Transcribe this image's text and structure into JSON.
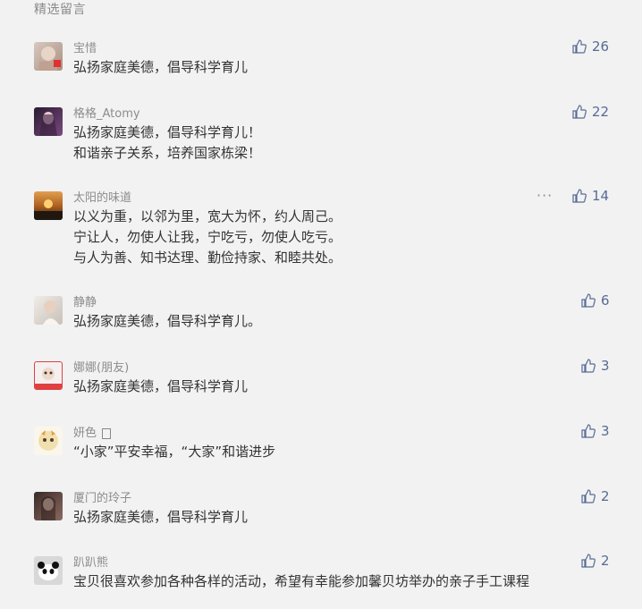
{
  "section_title": "精选留言",
  "comments": [
    {
      "nick": "宝惜",
      "text_lines": [
        "弘扬家庭美德，倡导科学育儿"
      ],
      "likes": "26"
    },
    {
      "nick": "格格_Atomy",
      "text_lines": [
        "弘扬家庭美德，倡导科学育儿！",
        "和谐亲子关系，培养国家栋梁！"
      ],
      "likes": "22"
    },
    {
      "nick": "太阳的味道",
      "text_lines": [
        "以义为重，以邻为里，宽大为怀，约人周己。",
        "宁让人，勿使人让我，宁吃亏，勿使人吃亏。",
        "与人为善、知书达理、勤俭持家、和睦共处。"
      ],
      "likes": "14",
      "more": "···"
    },
    {
      "nick": "静静",
      "text_lines": [
        "弘扬家庭美德，倡导科学育儿。"
      ],
      "likes": "6"
    },
    {
      "nick": "娜娜(朋友)",
      "text_lines": [
        "弘扬家庭美德，倡导科学育儿"
      ],
      "likes": "3"
    },
    {
      "nick": "妍色",
      "text_lines": [
        "“小家”平安幸福，“大家”和谐进步"
      ],
      "likes": "3"
    },
    {
      "nick": "厦门的玲子",
      "text_lines": [
        "弘扬家庭美德，倡导科学育儿"
      ],
      "likes": "2"
    },
    {
      "nick": "趴趴熊",
      "text_lines": [
        "宝贝很喜欢参加各种各样的活动，希望有幸能参加馨贝坊举办的亲子手工课程"
      ],
      "likes": "2"
    }
  ],
  "like_color": "#576b95",
  "icons": {
    "like": "thumbs-up-icon",
    "more": "more-icon"
  }
}
